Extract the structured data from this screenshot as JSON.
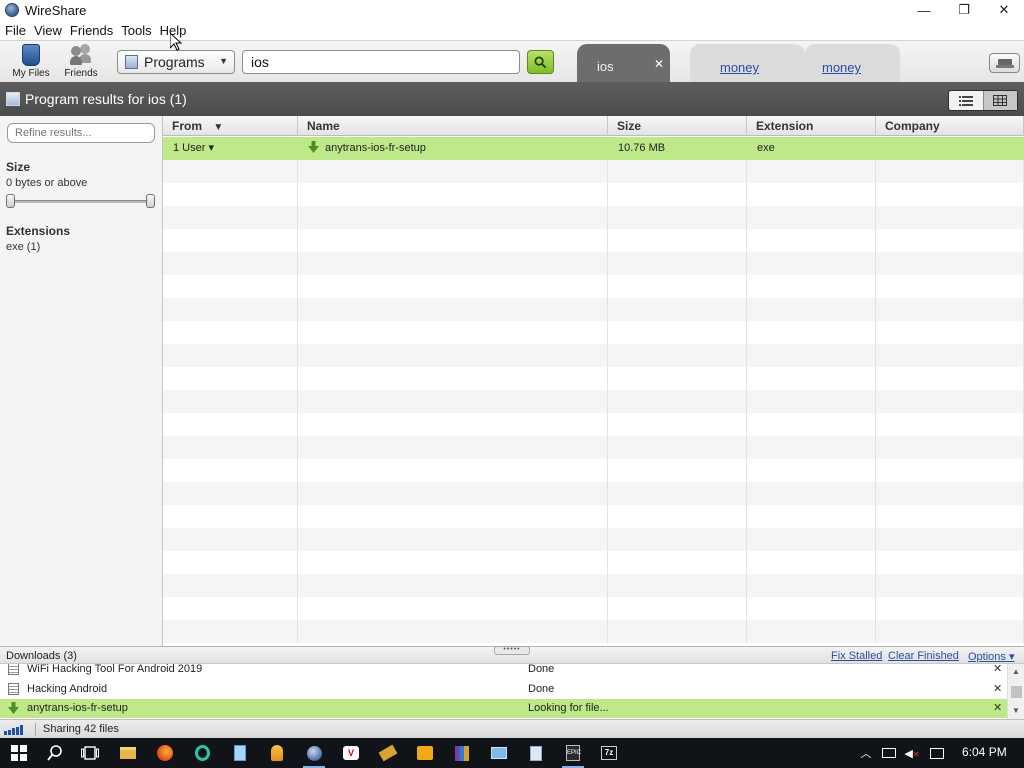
{
  "window": {
    "title": "WireShare",
    "controls": {
      "minimize": "—",
      "restore": "❐",
      "close": "✕"
    }
  },
  "menu": [
    "File",
    "View",
    "Friends",
    "Tools",
    "Help"
  ],
  "toolbar": {
    "my_files_label": "My Files",
    "friends_label": "Friends",
    "category": "Programs",
    "search_value": "ios"
  },
  "tabs": [
    {
      "label": "ios",
      "active": true,
      "close": "✕"
    },
    {
      "label": "money",
      "active": false
    },
    {
      "label": "money",
      "active": false
    }
  ],
  "results": {
    "title": "Program results for ios (1)"
  },
  "sidebar": {
    "refine_placeholder": "Refine results...",
    "size_heading": "Size",
    "size_value": "0 bytes or above",
    "size_slider_min": 0,
    "size_slider_max": 1,
    "extensions_heading": "Extensions",
    "extensions": [
      "exe (1)"
    ]
  },
  "table": {
    "columns": [
      "From",
      "Name",
      "Size",
      "Extension",
      "Company"
    ],
    "sort_indicator": "▼",
    "rows": [
      {
        "from": "1 User ▾",
        "name": "anytrans-ios-fr-setup",
        "size": "10.76 MB",
        "extension": "exe",
        "company": ""
      }
    ],
    "empty_rows": 21
  },
  "downloads": {
    "title": "Downloads (3)",
    "fix_stalled": "Fix Stalled",
    "clear_finished": "Clear Finished",
    "options": "Options ▾",
    "grip": "•••••",
    "items": [
      {
        "name": "WiFi Hacking Tool For Android 2019",
        "status": "Done",
        "close": "✕"
      },
      {
        "name": "Hacking Android",
        "status": "Done",
        "close": "✕"
      },
      {
        "name": "anytrans-ios-fr-setup",
        "status": "Looking for file...",
        "close": "✕"
      }
    ]
  },
  "status_bar": {
    "sharing": "Sharing 42 files"
  },
  "taskbar": {
    "clock": "6:04 PM"
  },
  "colors": {
    "selected_row": "#bfe889",
    "active_tab": "#6d6d6d",
    "link": "#2c4c9e"
  }
}
